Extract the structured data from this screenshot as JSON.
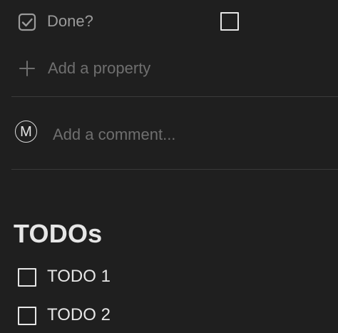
{
  "property": {
    "label": "Done?",
    "icon": "checkbox-property-icon",
    "checked": false
  },
  "add_property": {
    "label": "Add a property",
    "icon": "plus-icon"
  },
  "comment": {
    "avatar_initial": "M",
    "placeholder": "Add a comment..."
  },
  "section": {
    "heading": "TODOs"
  },
  "todos": [
    {
      "label": "TODO 1",
      "checked": false
    },
    {
      "label": "TODO 2",
      "checked": false
    }
  ],
  "colors": {
    "background": "#1f1f1f",
    "text": "#e6e6e6",
    "muted": "#9b9b9b",
    "placeholder": "#6f6f6f",
    "divider": "#3a3a3a"
  }
}
